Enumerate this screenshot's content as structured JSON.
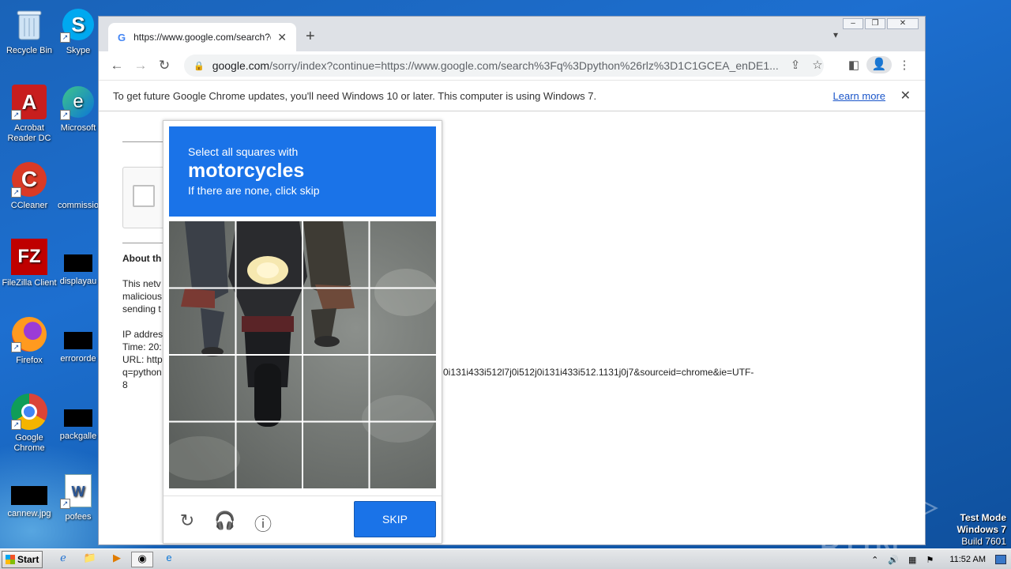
{
  "desktop": {
    "icons": [
      {
        "label": "Recycle Bin",
        "glyph": "🗑"
      },
      {
        "label": "Acrobat Reader DC",
        "glyph": "A"
      },
      {
        "label": "CCleaner",
        "glyph": "C"
      },
      {
        "label": "FileZilla Client",
        "glyph": "FZ"
      },
      {
        "label": "Firefox",
        "glyph": "🦊"
      },
      {
        "label": "Google Chrome",
        "glyph": "◉"
      },
      {
        "label": "cannew.jpg",
        "glyph": ""
      },
      {
        "label": "Skype",
        "glyph": "S"
      },
      {
        "label": "Microsoft",
        "glyph": "e"
      },
      {
        "label": "commissio",
        "glyph": ""
      },
      {
        "label": "displayau",
        "glyph": ""
      },
      {
        "label": "errororde",
        "glyph": ""
      },
      {
        "label": "packgalle",
        "glyph": ""
      },
      {
        "label": "pofees",
        "glyph": "W"
      }
    ]
  },
  "browser": {
    "tab_title": "https://www.google.com/search?q=",
    "tab_favicon": "G",
    "new_tab": "+",
    "url_domain": "google.com",
    "url_rest": "/sorry/index?continue=https://www.google.com/search%3Fq%3Dpython%26rlz%3D1C1GCEA_enDE1...",
    "infobar_text": "To get future Google Chrome updates, you'll need Windows 10 or later. This computer is using Windows 7.",
    "infobar_link": "Learn more"
  },
  "page": {
    "about_heading": "About th",
    "para_lines": [
      "This netv",
      "malicious",
      "sending t"
    ],
    "ip_line": "IP addres",
    "time_line": "Time: 20:",
    "url_label": "URL: http",
    "url_cont_left": "q=python",
    "url_cont_right": "0i131i433i512l7j0i512j0i131i433i512.1131j0j7&sourceid=chrome&ie=UTF-",
    "url_last": "8"
  },
  "captcha": {
    "line1": "Select all squares with",
    "target": "motorcycles",
    "line3": "If there are none, click skip",
    "skip_label": "SKIP",
    "grid_rows": 4,
    "grid_cols": 4
  },
  "watermark": {
    "logo": "ANY ▷ RUN",
    "mode": "Test Mode",
    "os": "Windows 7",
    "build": "Build 7601"
  },
  "taskbar": {
    "start": "Start",
    "clock": "11:52 AM"
  },
  "colors": {
    "captcha_blue": "#1a73e8",
    "desktop_blue": "#1d6fd0"
  }
}
